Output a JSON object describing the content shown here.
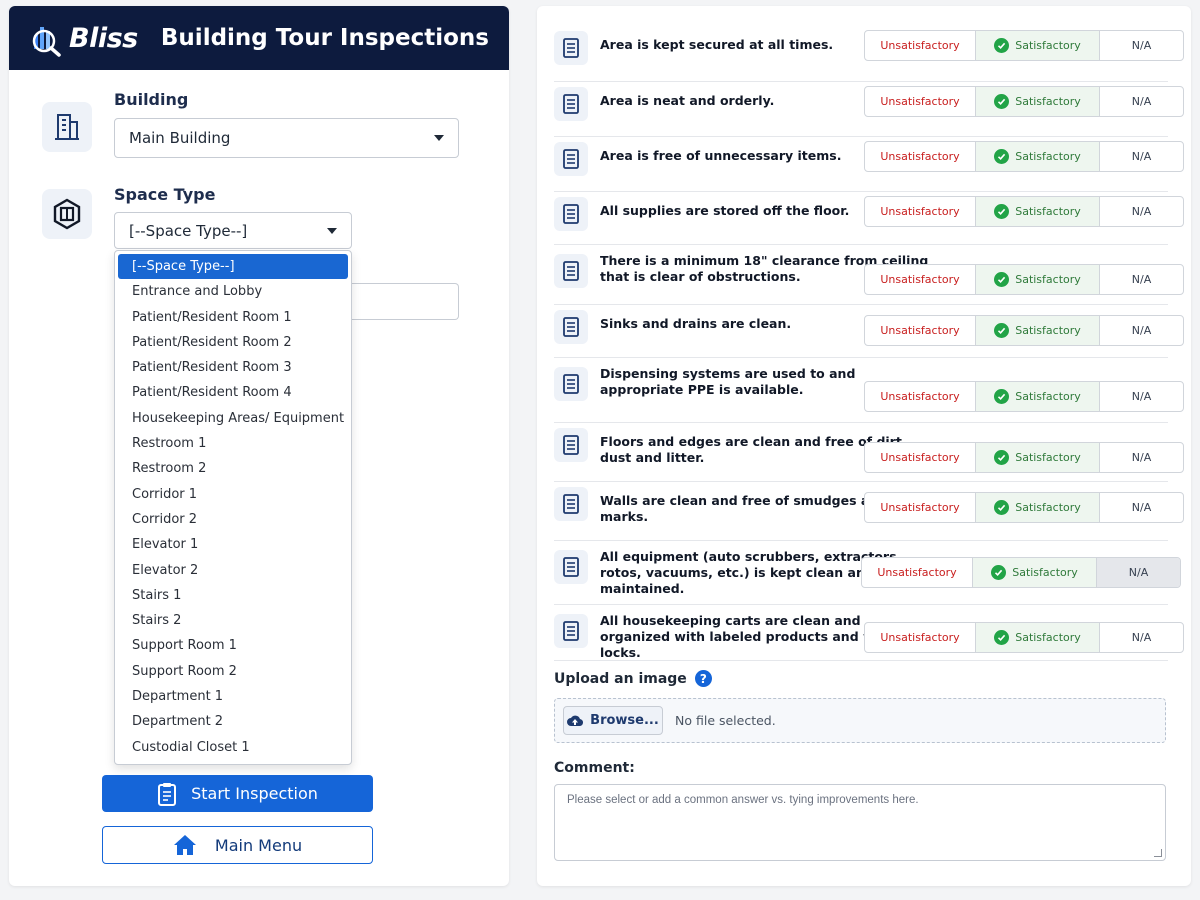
{
  "header": {
    "logo_text": "Bliss",
    "title": "Building Tour Inspections"
  },
  "building": {
    "label": "Building",
    "value": "Main Building"
  },
  "space_type": {
    "label": "Space Type",
    "value": "[--Space Type--]",
    "options": [
      "[--Space Type--]",
      "Entrance and Lobby",
      "Patient/Resident Room 1",
      "Patient/Resident Room 2",
      "Patient/Resident Room 3",
      "Patient/Resident Room 4",
      "Housekeeping Areas/ Equipment",
      "Restroom 1",
      "Restroom 2",
      "Corridor 1",
      "Corridor 2",
      "Elevator 1",
      "Elevator 2",
      "Stairs 1",
      "Stairs 2",
      "Support Room 1",
      "Support Room 2",
      "Department 1",
      "Department 2",
      "Custodial Closet 1"
    ]
  },
  "buttons": {
    "start": "Start Inspection",
    "main_menu": "Main Menu"
  },
  "ratings": {
    "unsatisfactory": "Unsatisfactory",
    "satisfactory": "Satisfactory",
    "na": "N/A"
  },
  "questions": [
    "Area is kept secured at all times.",
    "Area is neat and orderly.",
    "Area is free of unnecessary items.",
    "All supplies are stored off the floor.",
    "There is a minimum 18\" clearance from ceiling that is clear of obstructions.",
    "Sinks and drains are clean.",
    "Dispensing systems are used to and appropriate PPE is available.",
    "Floors and edges are clean and free of dirt, dust and litter.",
    "Walls are clean and free of smudges and marks.",
    "All equipment (auto scrubbers, extractors, rotos, vacuums, etc.) is kept clean and well maintained.",
    "All housekeeping carts are clean and organized with labeled products and working locks."
  ],
  "upload": {
    "label": "Upload an image",
    "help": "?",
    "browse": "Browse...",
    "no_file": "No file selected."
  },
  "comment": {
    "label": "Comment:",
    "placeholder": "Please select or add a common answer vs. tying improvements here."
  },
  "colors": {
    "header_bg": "#0d1b3e",
    "primary": "#1565d8",
    "unsatisfactory": "#c81e1e",
    "satisfactory": "#2f7a3a"
  }
}
